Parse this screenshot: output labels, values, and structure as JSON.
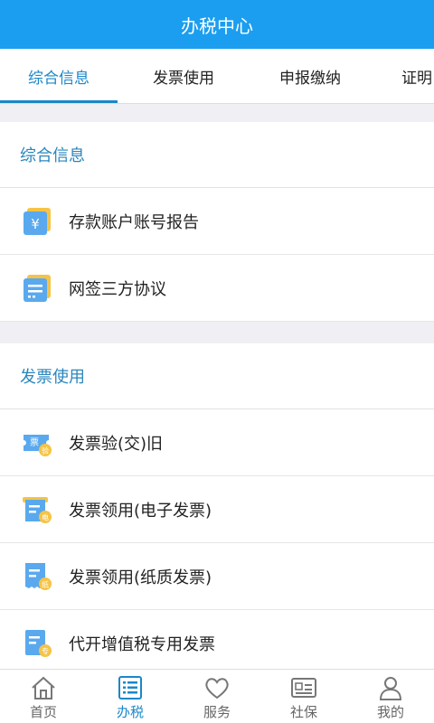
{
  "header": {
    "title": "办税中心"
  },
  "tabs": [
    {
      "label": "综合信息",
      "active": true
    },
    {
      "label": "发票使用"
    },
    {
      "label": "申报缴纳"
    },
    {
      "label": "证明"
    }
  ],
  "sections": [
    {
      "title": "综合信息",
      "items": [
        {
          "label": "存款账户账号报告",
          "icon": "deposit-account-icon",
          "badge": "¥"
        },
        {
          "label": "网签三方协议",
          "icon": "agreement-icon"
        }
      ]
    },
    {
      "title": "发票使用",
      "items": [
        {
          "label": "发票验(交)旧",
          "icon": "invoice-verify-icon",
          "badge": "票",
          "sub_badge": "验"
        },
        {
          "label": "发票领用(电子发票)",
          "icon": "e-invoice-icon",
          "sub_badge": "电"
        },
        {
          "label": "发票领用(纸质发票)",
          "icon": "paper-invoice-icon",
          "sub_badge": "纸"
        },
        {
          "label": "代开增值税专用发票",
          "icon": "vat-invoice-icon",
          "sub_badge": "专"
        }
      ]
    }
  ],
  "bottom_nav": [
    {
      "label": "首页",
      "icon": "home-icon"
    },
    {
      "label": "办税",
      "icon": "tax-icon",
      "active": true
    },
    {
      "label": "服务",
      "icon": "heart-icon"
    },
    {
      "label": "社保",
      "icon": "id-card-icon"
    },
    {
      "label": "我的",
      "icon": "user-icon"
    }
  ],
  "colors": {
    "accent": "#1b87c9",
    "titlebar": "#1b9ef0",
    "icon_blue": "#5aa9ee",
    "icon_yellow": "#f6c344"
  }
}
